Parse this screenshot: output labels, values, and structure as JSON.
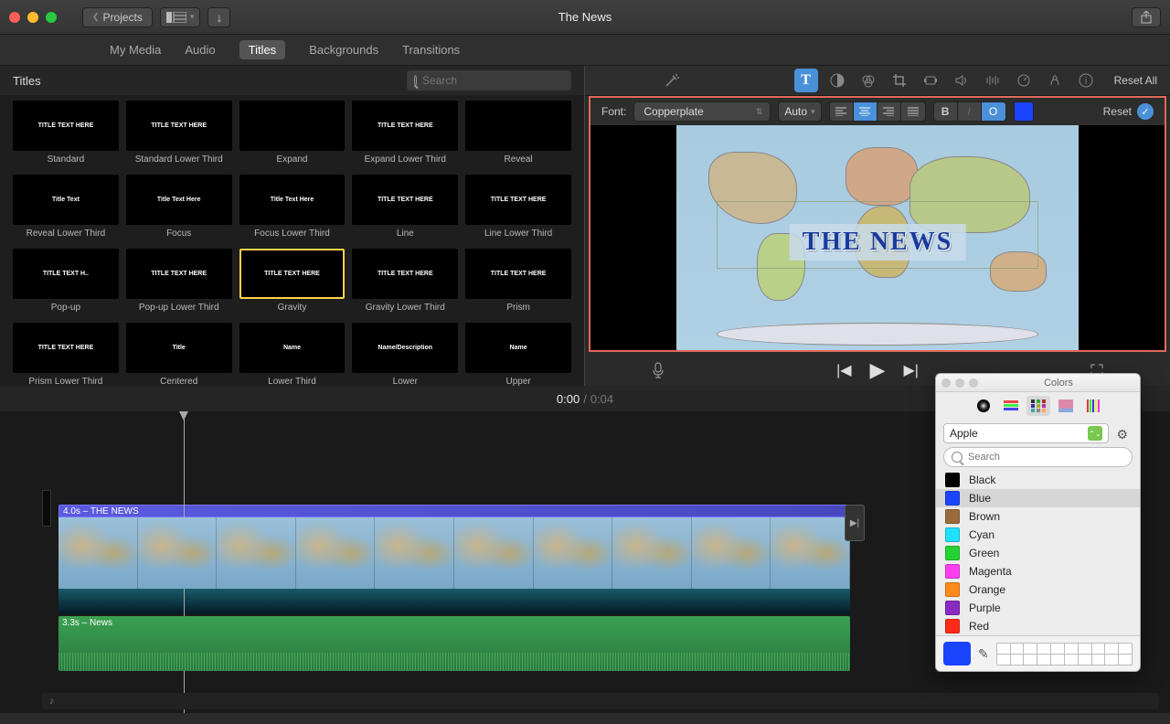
{
  "project_title": "The News",
  "projects_btn": "Projects",
  "secondary_tabs": [
    "My Media",
    "Audio",
    "Titles",
    "Backgrounds",
    "Transitions"
  ],
  "active_secondary_tab": 2,
  "left_header": "Titles",
  "search_placeholder": "Search",
  "titles": [
    {
      "label": "Standard",
      "txt": "TITLE TEXT HERE"
    },
    {
      "label": "Standard Lower Third",
      "txt": "TITLE TEXT HERE"
    },
    {
      "label": "Expand",
      "txt": ""
    },
    {
      "label": "Expand Lower Third",
      "txt": "TITLE TEXT HERE"
    },
    {
      "label": "Reveal",
      "txt": ""
    },
    {
      "label": "Reveal Lower Third",
      "txt": "Title Text"
    },
    {
      "label": "Focus",
      "txt": "Title Text Here"
    },
    {
      "label": "Focus Lower Third",
      "txt": "Title Text Here"
    },
    {
      "label": "Line",
      "txt": "TITLE TEXT HERE"
    },
    {
      "label": "Line Lower Third",
      "txt": "TITLE TEXT HERE"
    },
    {
      "label": "Pop-up",
      "txt": "TITLE TEXT H.."
    },
    {
      "label": "Pop-up Lower Third",
      "txt": "TITLE TEXT HERE"
    },
    {
      "label": "Gravity",
      "txt": "TITLE TEXT HERE",
      "selected": true
    },
    {
      "label": "Gravity Lower Third",
      "txt": "TITLE TEXT HERE"
    },
    {
      "label": "Prism",
      "txt": "TITLE TEXT HERE"
    },
    {
      "label": "Prism Lower Third",
      "txt": "TITLE TEXT HERE"
    },
    {
      "label": "Centered",
      "txt": "Title"
    },
    {
      "label": "Lower Third",
      "txt": "Name"
    },
    {
      "label": "Lower",
      "txt": "Name/Description"
    },
    {
      "label": "Upper",
      "txt": "Name"
    }
  ],
  "reset_all": "Reset All",
  "stylebar": {
    "font_label": "Font:",
    "font_value": "Copperplate",
    "size_value": "Auto",
    "bold": "B",
    "italic": "I",
    "outline": "O",
    "reset": "Reset"
  },
  "preview_title": "THE NEWS",
  "timeline": {
    "current": "0:00",
    "duration": "0:04",
    "title_clip": "4.0s – THE NEWS",
    "audio_clip": "3.3s – News"
  },
  "colors_panel": {
    "title": "Colors",
    "palette": "Apple",
    "search_placeholder": "Search",
    "list": [
      {
        "name": "Black",
        "c": "#000000"
      },
      {
        "name": "Blue",
        "c": "#1a44ff",
        "selected": true
      },
      {
        "name": "Brown",
        "c": "#9a6a3a"
      },
      {
        "name": "Cyan",
        "c": "#20e0ff"
      },
      {
        "name": "Green",
        "c": "#26d233"
      },
      {
        "name": "Magenta",
        "c": "#ff3ef0"
      },
      {
        "name": "Orange",
        "c": "#ff8a1a"
      },
      {
        "name": "Purple",
        "c": "#8a2ac0"
      },
      {
        "name": "Red",
        "c": "#ff2a1a"
      }
    ],
    "current": "#1a44ff"
  }
}
